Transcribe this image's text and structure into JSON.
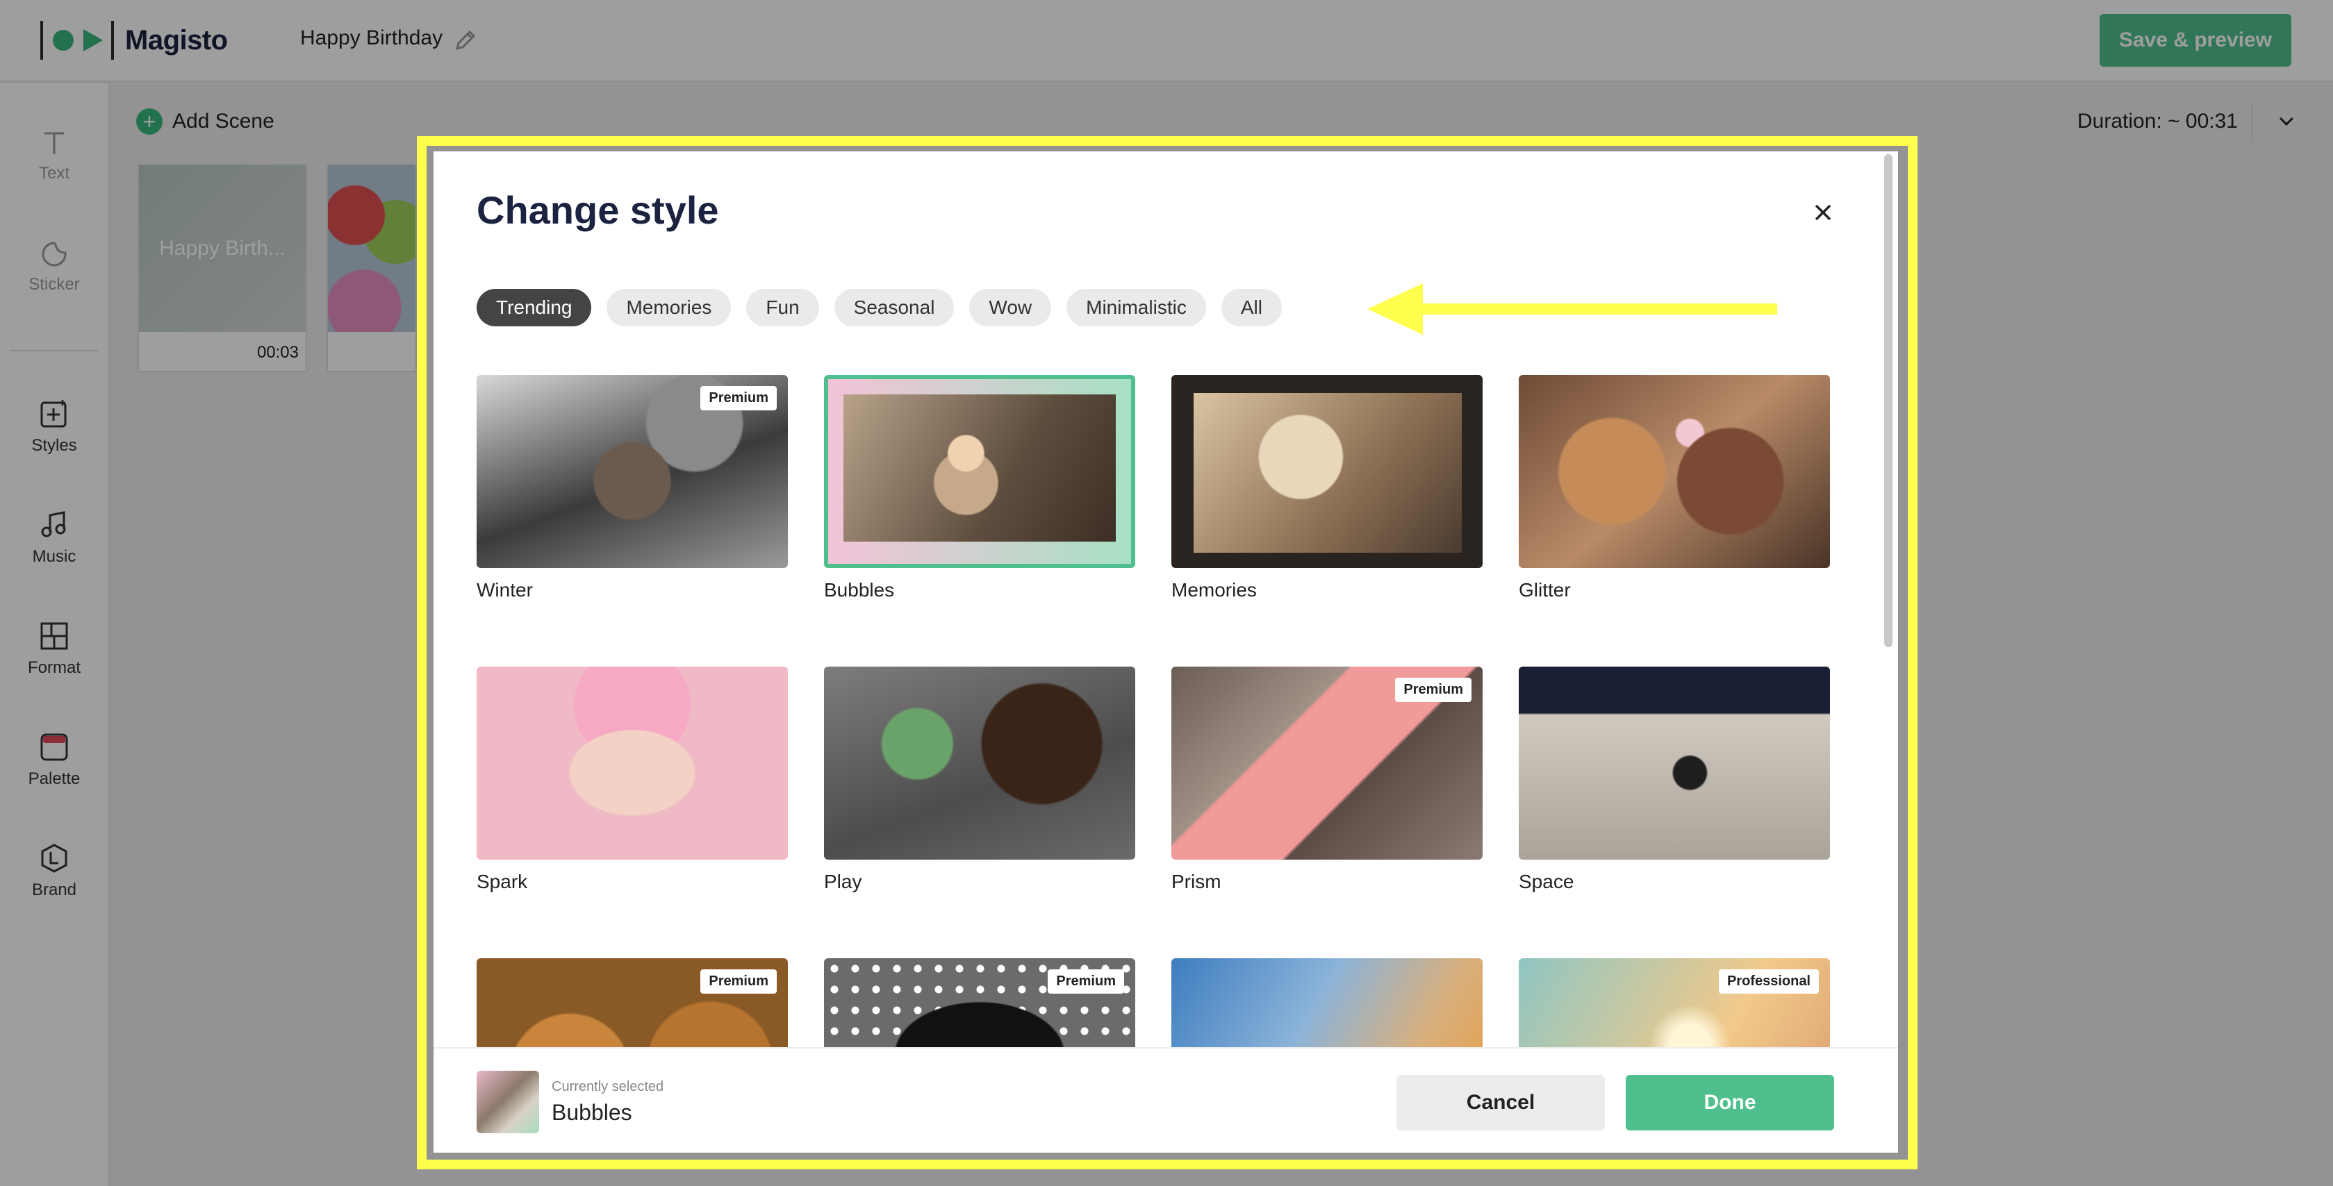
{
  "app": {
    "brand": "Magisto",
    "project_title": "Happy Birthday",
    "save_label": "Save & preview"
  },
  "sidebar": {
    "items": [
      {
        "label": "Text",
        "icon": "text-icon"
      },
      {
        "label": "Sticker",
        "icon": "sticker-icon"
      },
      {
        "label": "Styles",
        "icon": "styles-icon"
      },
      {
        "label": "Music",
        "icon": "music-icon"
      },
      {
        "label": "Format",
        "icon": "format-icon"
      },
      {
        "label": "Palette",
        "icon": "palette-icon"
      },
      {
        "label": "Brand",
        "icon": "brand-icon"
      }
    ]
  },
  "editor": {
    "add_scene_label": "Add Scene",
    "duration_label": "Duration: ~ 00:31",
    "scenes": [
      {
        "title": "Happy Birth...",
        "time": "00:03"
      }
    ]
  },
  "modal": {
    "title": "Change style",
    "tabs": [
      "Trending",
      "Memories",
      "Fun",
      "Seasonal",
      "Wow",
      "Minimalistic",
      "All"
    ],
    "active_tab": "Trending",
    "styles": [
      {
        "name": "Winter",
        "badge": "Premium"
      },
      {
        "name": "Bubbles",
        "badge": ""
      },
      {
        "name": "Memories",
        "badge": ""
      },
      {
        "name": "Glitter",
        "badge": ""
      },
      {
        "name": "Spark",
        "badge": ""
      },
      {
        "name": "Play",
        "badge": ""
      },
      {
        "name": "Prism",
        "badge": "Premium"
      },
      {
        "name": "Space",
        "badge": ""
      },
      {
        "name": "",
        "badge": "Premium"
      },
      {
        "name": "",
        "badge": "Premium"
      },
      {
        "name": "",
        "badge": ""
      },
      {
        "name": "",
        "badge": "Professional"
      }
    ],
    "footer": {
      "currently_selected_label": "Currently selected",
      "selected_name": "Bubbles",
      "cancel_label": "Cancel",
      "done_label": "Done"
    }
  },
  "colors": {
    "accent_green": "#4fc08d",
    "highlight_yellow": "#ffff4e",
    "active_tab": "#444444"
  }
}
